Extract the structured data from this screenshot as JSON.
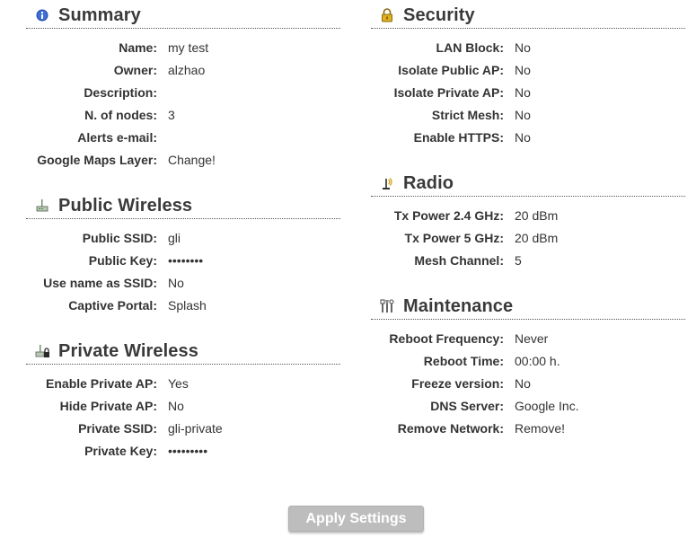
{
  "summary": {
    "title": "Summary",
    "icon": "info-icon",
    "rows": [
      {
        "label": "Name:",
        "value": "my test"
      },
      {
        "label": "Owner:",
        "value": "alzhao"
      },
      {
        "label": "Description:",
        "value": ""
      },
      {
        "label": "N. of nodes:",
        "value": "3"
      },
      {
        "label": "Alerts e-mail:",
        "value": ""
      },
      {
        "label": "Google Maps Layer:",
        "value": "Change!"
      }
    ]
  },
  "public_wireless": {
    "title": "Public Wireless",
    "icon": "wireless-router-icon",
    "rows": [
      {
        "label": "Public SSID:",
        "value": "gli"
      },
      {
        "label": "Public Key:",
        "value": "••••••••"
      },
      {
        "label": "Use name as SSID:",
        "value": "No"
      },
      {
        "label": "Captive Portal:",
        "value": "Splash"
      }
    ]
  },
  "private_wireless": {
    "title": "Private Wireless",
    "icon": "locked-router-icon",
    "rows": [
      {
        "label": "Enable Private AP:",
        "value": "Yes"
      },
      {
        "label": "Hide Private AP:",
        "value": "No"
      },
      {
        "label": "Private SSID:",
        "value": "gli-private"
      },
      {
        "label": "Private Key:",
        "value": "•••••••••"
      }
    ]
  },
  "security": {
    "title": "Security",
    "icon": "lock-icon",
    "rows": [
      {
        "label": "LAN Block:",
        "value": "No"
      },
      {
        "label": "Isolate Public AP:",
        "value": "No"
      },
      {
        "label": "Isolate Private AP:",
        "value": "No"
      },
      {
        "label": "Strict Mesh:",
        "value": "No"
      },
      {
        "label": "Enable HTTPS:",
        "value": "No"
      }
    ]
  },
  "radio": {
    "title": "Radio",
    "icon": "antenna-icon",
    "rows": [
      {
        "label": "Tx Power 2.4 GHz:",
        "value": "20 dBm"
      },
      {
        "label": "Tx Power 5 GHz:",
        "value": "20 dBm"
      },
      {
        "label": "Mesh Channel:",
        "value": "5"
      }
    ]
  },
  "maintenance": {
    "title": "Maintenance",
    "icon": "tools-icon",
    "rows": [
      {
        "label": "Reboot Frequency:",
        "value": "Never"
      },
      {
        "label": "Reboot Time:",
        "value": "00:00 h."
      },
      {
        "label": "Freeze version:",
        "value": "No"
      },
      {
        "label": "DNS Server:",
        "value": "Google Inc."
      },
      {
        "label": "Remove Network:",
        "value": "Remove!"
      }
    ]
  },
  "apply_button": {
    "label": "Apply Settings"
  }
}
